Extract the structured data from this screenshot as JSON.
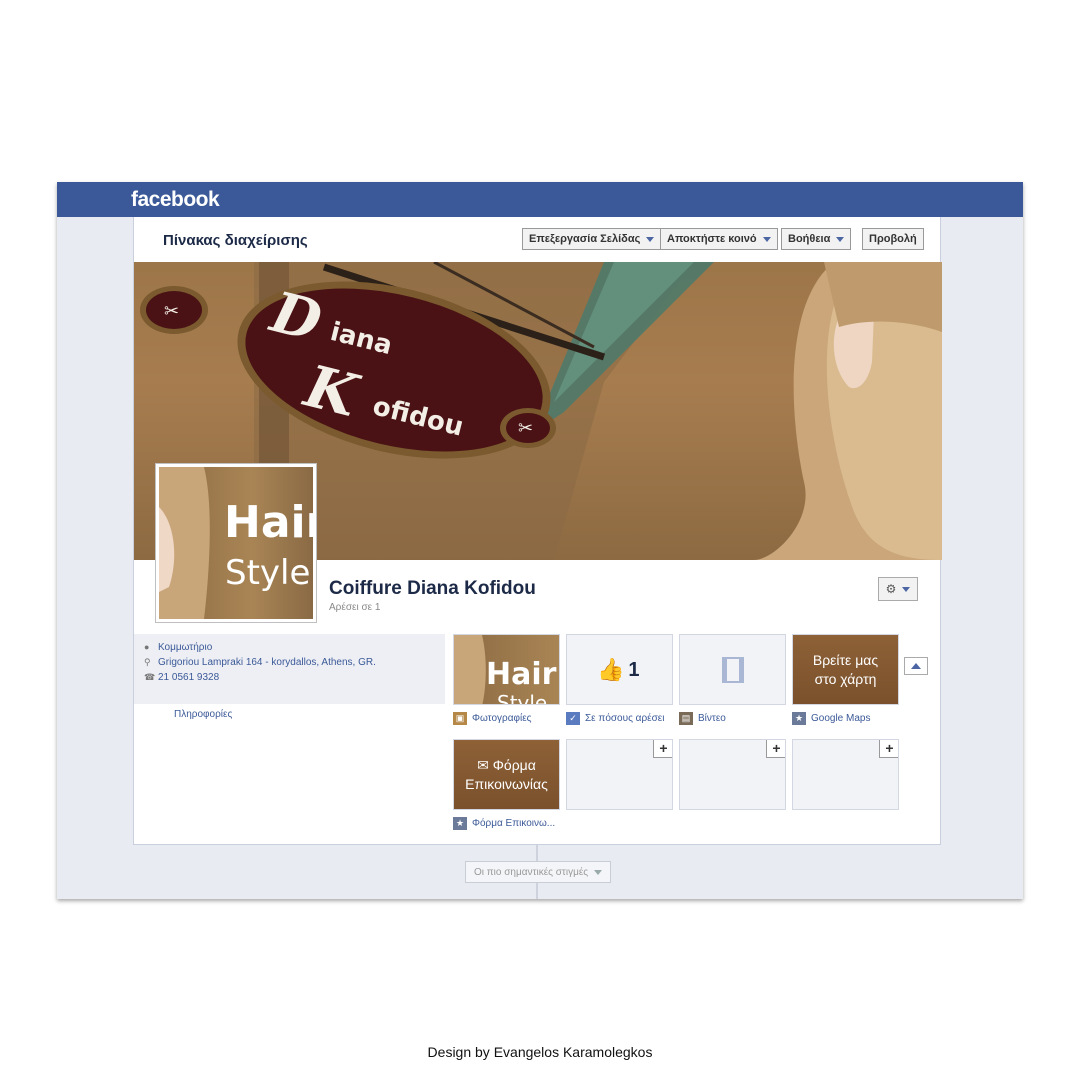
{
  "facebook": {
    "logo": "facebook"
  },
  "admin": {
    "title": "Πίνακας διαχείρισης",
    "buttons": {
      "edit_page": "Επεξεργασία Σελίδας",
      "get_audience": "Αποκτήστε κοινό",
      "help": "Βοήθεια",
      "view": "Προβολή"
    }
  },
  "cover": {
    "sign_line1_initial": "D",
    "sign_line1_rest": "iana",
    "sign_line2_initial": "K",
    "sign_line2_rest": "ofidou",
    "wall_text": "Hair Style"
  },
  "profile": {
    "line1": "Hair",
    "line2": "Style"
  },
  "page": {
    "name": "Coiffure Diana Kofidou",
    "likes": "Αρέσει σε 1"
  },
  "about": {
    "category": "Κομμωτήριο",
    "address": "Grigoriou Lampraki 164 - korydallos, Athens, GR.",
    "phone": "21 0561 9328",
    "info_link": "Πληροφορίες"
  },
  "apps": [
    {
      "label": "Φωτογραφίες",
      "tile_text_1": "Hair",
      "tile_text_2": "Style",
      "icon": "photos-icon"
    },
    {
      "label": "Σε πόσους αρέσει",
      "count": "1",
      "icon": "like-icon"
    },
    {
      "label": "Βίντεο",
      "icon": "video-icon"
    },
    {
      "label": "Google Maps",
      "tile_text_1": "Βρείτε μας",
      "tile_text_2": "στο χάρτη",
      "icon": "star-icon"
    },
    {
      "label": "Φόρμα Επικοινω...",
      "tile_text_1": "Φόρμα",
      "tile_text_2": "Επικοινωνίας",
      "icon": "star-icon"
    }
  ],
  "timeline": {
    "highlights": "Οι πιο σημαντικές στιγμές"
  },
  "credit": "Design by Evangelos Karamolegkos",
  "colors": {
    "facebook_blue": "#3b5998",
    "sign_brown": "#4a1214",
    "tile_brown": "#7f552f"
  }
}
